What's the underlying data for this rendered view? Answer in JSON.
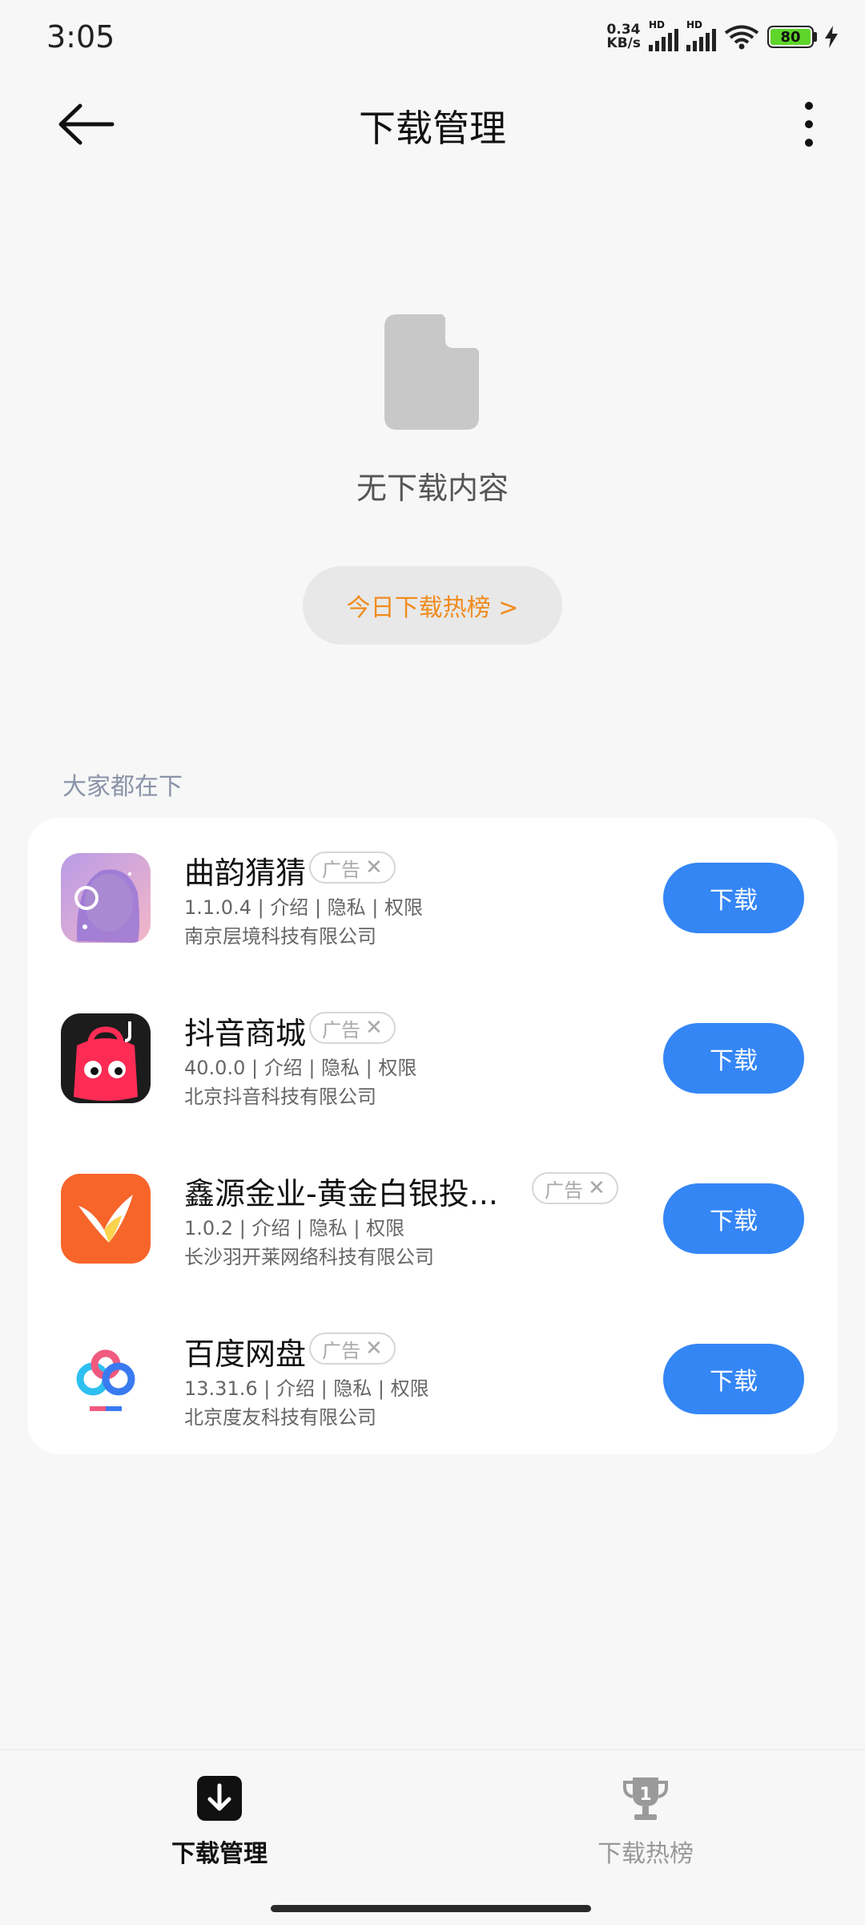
{
  "status_bar": {
    "time": "3:05",
    "net_speed_value": "0.34",
    "net_speed_unit": "KB/s",
    "sim1_label": "HD",
    "sim2_label": "HD",
    "battery_level": "80"
  },
  "header": {
    "title": "下载管理"
  },
  "empty_state": {
    "text": "无下载内容",
    "hot_button_label": "今日下载热榜 >"
  },
  "recommend": {
    "section_title": "大家都在下",
    "ad_label": "广告",
    "ad_close": "✕",
    "download_label": "下载",
    "apps": [
      {
        "name": "曲韵猜猜",
        "version": "1.1.0.4",
        "intro": "介绍",
        "privacy": "隐私",
        "permission": "权限",
        "developer": "南京层境科技有限公司"
      },
      {
        "name": "抖音商城",
        "version": "40.0.0",
        "intro": "介绍",
        "privacy": "隐私",
        "permission": "权限",
        "developer": "北京抖音科技有限公司"
      },
      {
        "name": "鑫源金业-黄金白银投...",
        "version": "1.0.2",
        "intro": "介绍",
        "privacy": "隐私",
        "permission": "权限",
        "developer": "长沙羽开莱网络科技有限公司"
      },
      {
        "name": "百度网盘",
        "version": "13.31.6",
        "intro": "介绍",
        "privacy": "隐私",
        "permission": "权限",
        "developer": "北京度友科技有限公司"
      }
    ]
  },
  "bottom_nav": {
    "tab_manage": "下载管理",
    "tab_rank": "下载热榜",
    "rank_icon_number": "1"
  }
}
